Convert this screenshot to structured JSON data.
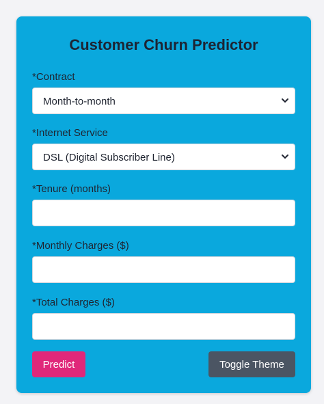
{
  "form": {
    "title": "Customer Churn Predictor",
    "contract": {
      "label": "*Contract",
      "value": "Month-to-month"
    },
    "internet_service": {
      "label": "*Internet Service",
      "value": "DSL (Digital Subscriber Line)"
    },
    "tenure": {
      "label": "*Tenure (months)",
      "value": ""
    },
    "monthly_charges": {
      "label": "*Monthly Charges ($)",
      "value": ""
    },
    "total_charges": {
      "label": "*Total Charges ($)",
      "value": ""
    },
    "predict_label": "Predict",
    "toggle_theme_label": "Toggle Theme"
  },
  "colors": {
    "card_background": "#0aa8dd",
    "predict_button": "#e0287a",
    "toggle_theme_button": "#4b5563"
  },
  "icons": {
    "dropdown": "chevron-down-icon"
  }
}
